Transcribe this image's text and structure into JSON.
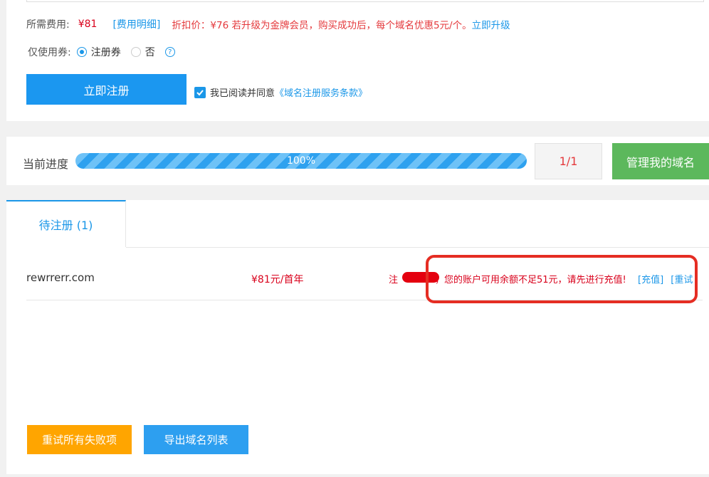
{
  "fee": {
    "label": "所需费用:",
    "amount": "¥81",
    "detail_link": "[费用明细]",
    "discount_text": "折扣价：¥76 若升级为金牌会员，购买成功后，每个域名优惠5元/个。",
    "upgrade_link": "立即升级"
  },
  "coupon": {
    "label": "仅使用券:",
    "option_yes": "注册券",
    "option_no": "否",
    "selected": "注册券",
    "help_glyph": "?"
  },
  "register": {
    "button_label": "立即注册",
    "agree_text": "我已阅读并同意",
    "terms_link": "《域名注册服务条款》",
    "agree_checked": true
  },
  "progress": {
    "label": "当前进度",
    "percent_text": "100%",
    "percent": 100,
    "count": "1/1",
    "manage_button": "管理我的域名"
  },
  "tabs": [
    {
      "label": "待注册 (1)",
      "active": true
    }
  ],
  "rows": [
    {
      "domain": "rewrrerr.com",
      "price": "¥81元/首年",
      "status_prefix": "注",
      "status_text": "，您的账户可用余额不足51元，请先进行充值!",
      "action_recharge": "[充值]",
      "action_retry": "[重试"
    }
  ],
  "footer": {
    "retry_all_button": "重试所有失败项",
    "export_button": "导出域名列表"
  },
  "colors": {
    "primary": "#1b97f0",
    "success": "#5cb85c",
    "warning": "#ffa500",
    "danger": "#e4393c",
    "highlight_border": "#e52d23"
  }
}
